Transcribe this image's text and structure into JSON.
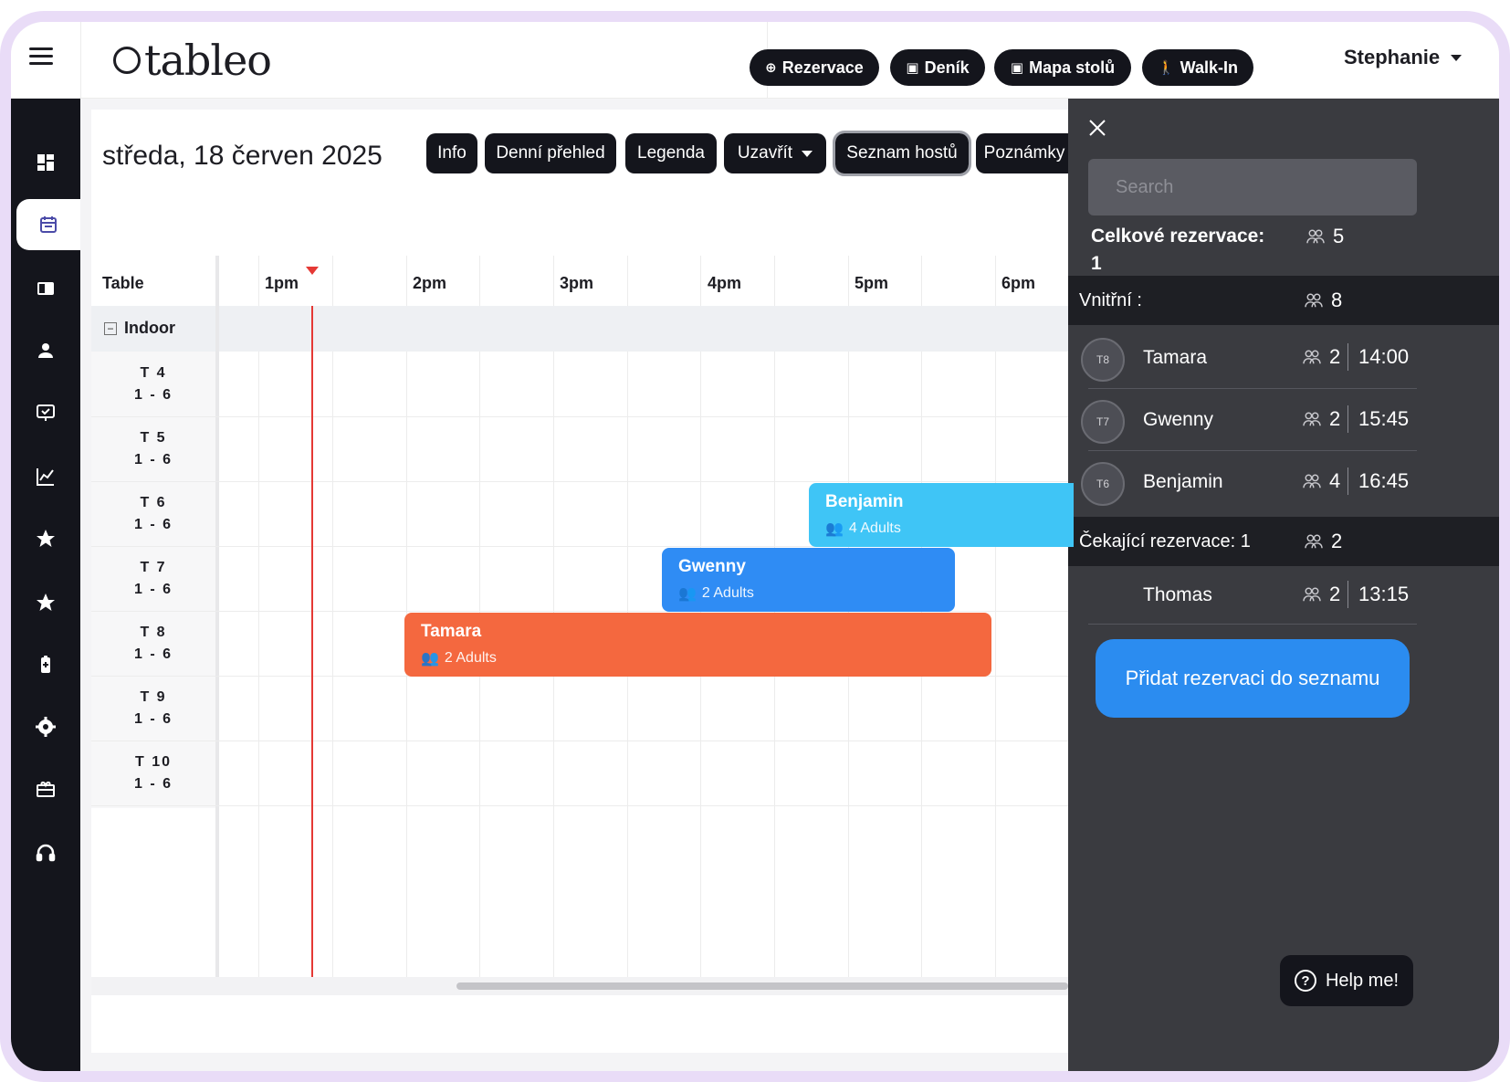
{
  "header": {
    "logo": "tableo",
    "nav": [
      {
        "label": "Rezervace",
        "icon": "plus-circle-icon"
      },
      {
        "label": "Deník",
        "icon": "calendar-icon"
      },
      {
        "label": "Mapa stolů",
        "icon": "calendar-icon"
      },
      {
        "label": "Walk-In",
        "icon": "walking-icon"
      }
    ],
    "user": "Stephanie"
  },
  "sidebar": {
    "items": [
      {
        "name": "dashboard-icon",
        "active": false
      },
      {
        "name": "calendar-icon",
        "active": true
      },
      {
        "name": "table-list-icon",
        "active": false
      },
      {
        "name": "user-icon",
        "active": false
      },
      {
        "name": "checklist-icon",
        "active": false
      },
      {
        "name": "chart-icon",
        "active": false
      },
      {
        "name": "star-icon",
        "active": false
      },
      {
        "name": "star-icon",
        "active": false
      },
      {
        "name": "clipboard-icon",
        "active": false
      },
      {
        "name": "gear-icon",
        "active": false
      },
      {
        "name": "gift-icon",
        "active": false
      },
      {
        "name": "headset-icon",
        "active": false
      }
    ]
  },
  "main": {
    "date": "středa, 18 červen 2025",
    "tools": [
      {
        "label": "Info"
      },
      {
        "label": "Denní přehled"
      },
      {
        "label": "Legenda"
      },
      {
        "label": "Uzavřít"
      },
      {
        "label": "Seznam hostů"
      },
      {
        "label": "Poznámky"
      }
    ],
    "table_header": "Table",
    "times": [
      "1pm",
      "2pm",
      "3pm",
      "4pm",
      "5pm",
      "6pm"
    ],
    "group": "Indoor",
    "rows": [
      {
        "table": "T 4",
        "capacity": "1 - 6"
      },
      {
        "table": "T 5",
        "capacity": "1 - 6"
      },
      {
        "table": "T 6",
        "capacity": "1 - 6"
      },
      {
        "table": "T 7",
        "capacity": "1 - 6"
      },
      {
        "table": "T 8",
        "capacity": "1 - 6"
      },
      {
        "table": "T 9",
        "capacity": "1 - 6"
      },
      {
        "table": "T 10",
        "capacity": "1 - 6"
      }
    ],
    "reservations": [
      {
        "name": "Benjamin",
        "guests": "4 Adults",
        "color": "#3fc5f6"
      },
      {
        "name": "Gwenny",
        "guests": "2 Adults",
        "color": "#2f8cf4"
      },
      {
        "name": "Tamara",
        "guests": "2 Adults",
        "color": "#f4683f"
      }
    ]
  },
  "panel": {
    "search_placeholder": "Search",
    "total_label": "Celkové rezervace:",
    "total_value": "1",
    "total_guests": "5",
    "indoor_label": "Vnitřní :",
    "indoor_guests": "8",
    "guests": [
      {
        "table": "T8",
        "name": "Tamara",
        "count": "2",
        "time": "14:00"
      },
      {
        "table": "T7",
        "name": "Gwenny",
        "count": "2",
        "time": "15:45"
      },
      {
        "table": "T6",
        "name": "Benjamin",
        "count": "4",
        "time": "16:45"
      }
    ],
    "waiting_label": "Čekající rezervace: 1",
    "waiting_guests": "2",
    "waiting": [
      {
        "name": "Thomas",
        "count": "2",
        "time": "13:15"
      }
    ],
    "add_button": "Přidat rezervaci do seznamu",
    "help_button": "Help me!"
  }
}
